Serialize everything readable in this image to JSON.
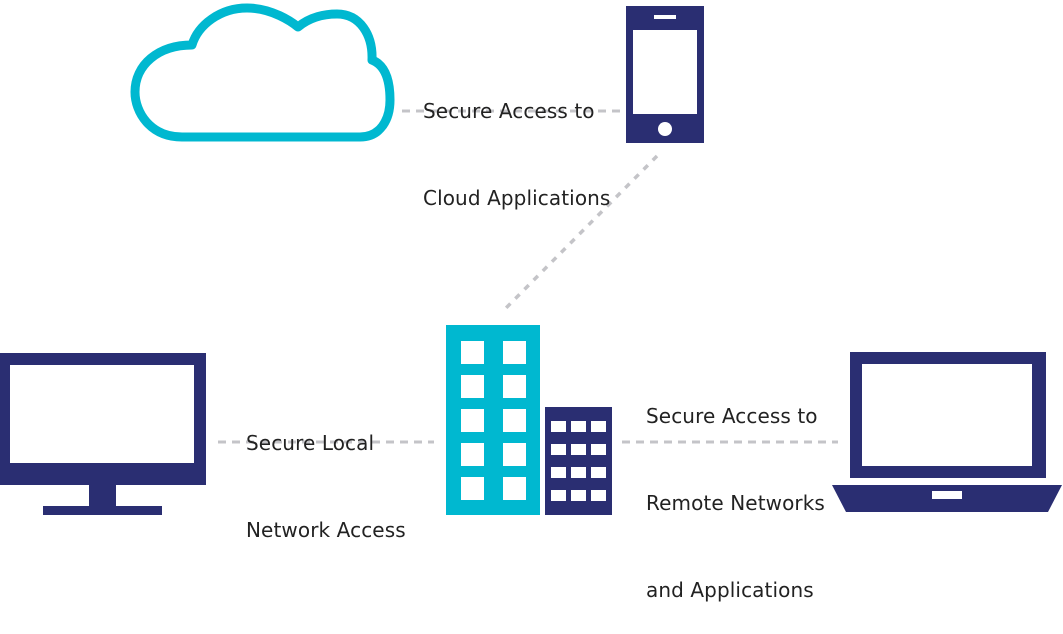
{
  "diagram": {
    "colors": {
      "cyan": "#00B8D0",
      "navy": "#2A2E72",
      "connector": "#C4C4C8",
      "text": "#222222",
      "window": "#FFFFFF"
    },
    "nodes": [
      {
        "id": "cloud",
        "label": "Cloud",
        "icon": "cloud-icon"
      },
      {
        "id": "mobile",
        "label": "Mobile Phone",
        "icon": "smartphone-icon"
      },
      {
        "id": "office",
        "label": "Office Buildings",
        "icon": "buildings-icon"
      },
      {
        "id": "desktop",
        "label": "Desktop Monitor",
        "icon": "monitor-icon"
      },
      {
        "id": "laptop",
        "label": "Laptop",
        "icon": "laptop-icon"
      }
    ],
    "connections": [
      {
        "from": "cloud",
        "to": "mobile",
        "style": "dashed",
        "label": [
          "Secure Access to",
          "Cloud Applications"
        ]
      },
      {
        "from": "mobile",
        "to": "office",
        "style": "dashed",
        "label": []
      },
      {
        "from": "desktop",
        "to": "office",
        "style": "dashed",
        "label": [
          "Secure Local",
          "Network Access"
        ]
      },
      {
        "from": "office",
        "to": "laptop",
        "style": "dashed",
        "label": [
          "Secure Access to",
          "Remote Networks",
          "and Applications"
        ]
      }
    ]
  }
}
